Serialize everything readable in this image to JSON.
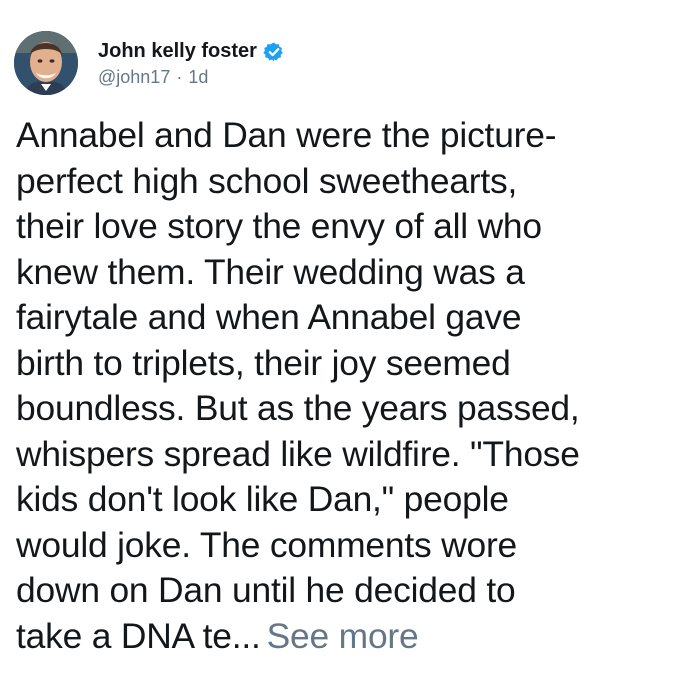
{
  "tweet": {
    "author": {
      "display_name": "John kelly foster",
      "handle": "@john17",
      "separator": "·",
      "timestamp": "1d",
      "verified_icon": "verified-badge-icon",
      "avatar_icon": "avatar-photo"
    },
    "body": {
      "lines": [
        "Annabel and Dan were the picture-",
        "perfect high school sweethearts,",
        "their love story the envy of all who",
        "knew them. Their wedding was a",
        "fairytale and when Annabel gave",
        "birth to triplets, their joy seemed",
        "boundless. But as the years passed,",
        "whispers spread like wildfire. \"Those",
        "kids don't look like Dan,\" people",
        "would joke. The comments wore",
        "down on Dan until he decided to",
        "take a DNA te..."
      ],
      "see_more": "See more"
    },
    "colors": {
      "text": "#14171a",
      "muted": "#657786",
      "verified": "#1da1f2"
    }
  }
}
